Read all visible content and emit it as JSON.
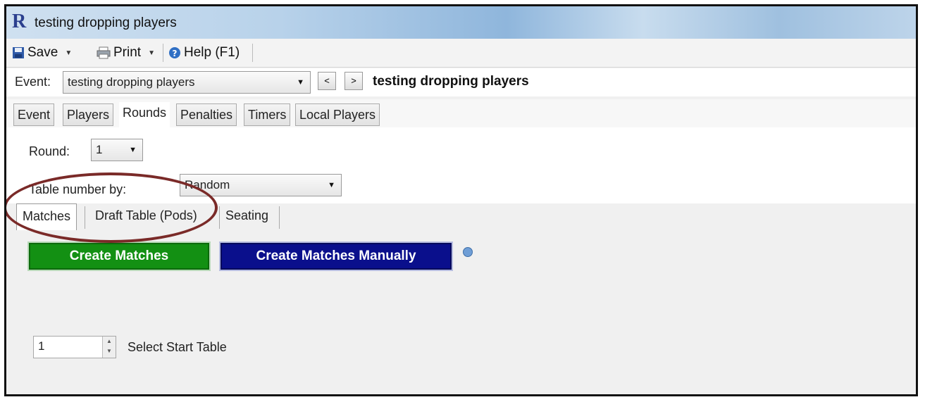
{
  "window": {
    "title": "testing dropping players"
  },
  "toolbar": {
    "save": "Save",
    "print": "Print",
    "help": "Help (F1)"
  },
  "eventbar": {
    "label": "Event:",
    "selected": "testing dropping players",
    "prev": "<",
    "next": ">",
    "event_name": "testing dropping players"
  },
  "tabs": [
    "Event",
    "Players",
    "Rounds",
    "Penalties",
    "Timers",
    "Local Players"
  ],
  "round": {
    "label": "Round:",
    "value": "1"
  },
  "table_number": {
    "label": "Table number by:",
    "value": "Random"
  },
  "subtabs": [
    "Matches",
    "Draft Table (Pods)",
    "Seating"
  ],
  "buttons": {
    "create": "Create Matches",
    "create_manual": "Create Matches Manually"
  },
  "start_table": {
    "value": "1",
    "label": "Select Start Table"
  },
  "colors": {
    "green": "#139013",
    "blue": "#0a0f8c",
    "highlight": "#7a2a28"
  }
}
